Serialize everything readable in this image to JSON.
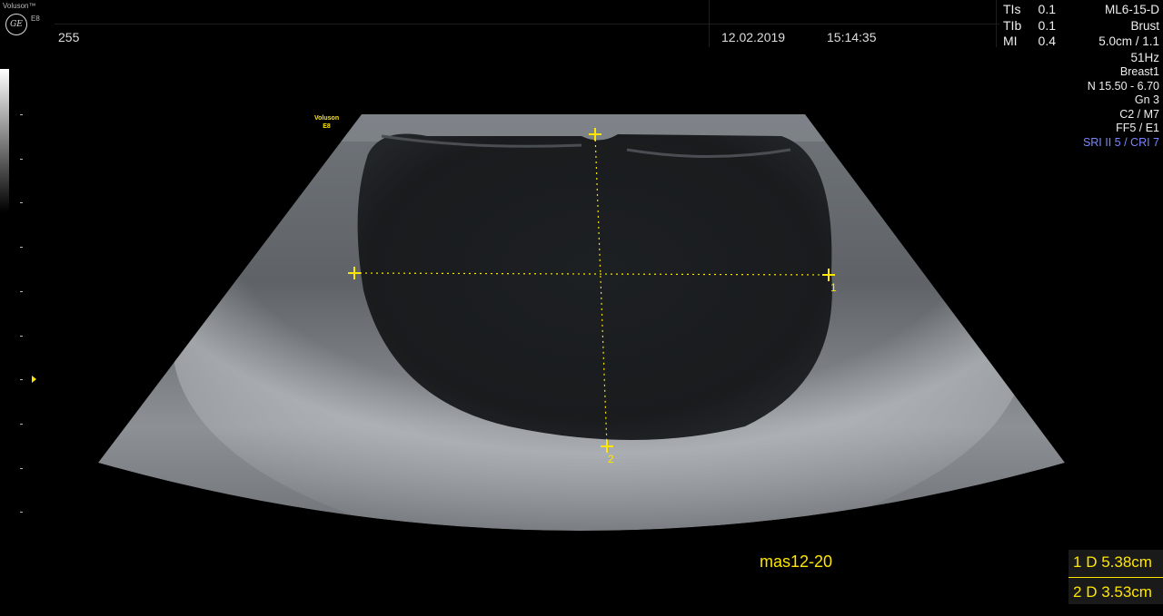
{
  "header": {
    "brand": "Voluson™",
    "model": "E8",
    "logo_text": "GE",
    "frame_number": "255",
    "date": "12.02.2019",
    "time": "15:14:35",
    "indices": [
      {
        "label": "TIs",
        "value": "0.1"
      },
      {
        "label": "TIb",
        "value": "0.1"
      },
      {
        "label": "MI",
        "value": "0.4"
      }
    ]
  },
  "params": {
    "probe": "ML6-15-D",
    "preset": "Brust",
    "depth": "5.0cm / 1.1",
    "frame_rate": "51Hz",
    "program": "Breast1",
    "frequency": "N 15.50 - 6.70",
    "gain": "Gn  3",
    "compound": "C2 / M7",
    "filter": "FF5 / E1",
    "sri": "SRI II 5 / CRI 7"
  },
  "probe_label": {
    "line1": "Voluson",
    "line2": "E8"
  },
  "annotation": "mas12-20",
  "measurements": [
    {
      "index": "1",
      "label": "D",
      "value": "5.38cm"
    },
    {
      "index": "2",
      "label": "D",
      "value": "3.53cm"
    }
  ],
  "caliper_numbers": [
    "1",
    "2"
  ],
  "colors": {
    "caliper": "#ffe600",
    "sri": "#7a86ff",
    "background": "#000000"
  }
}
